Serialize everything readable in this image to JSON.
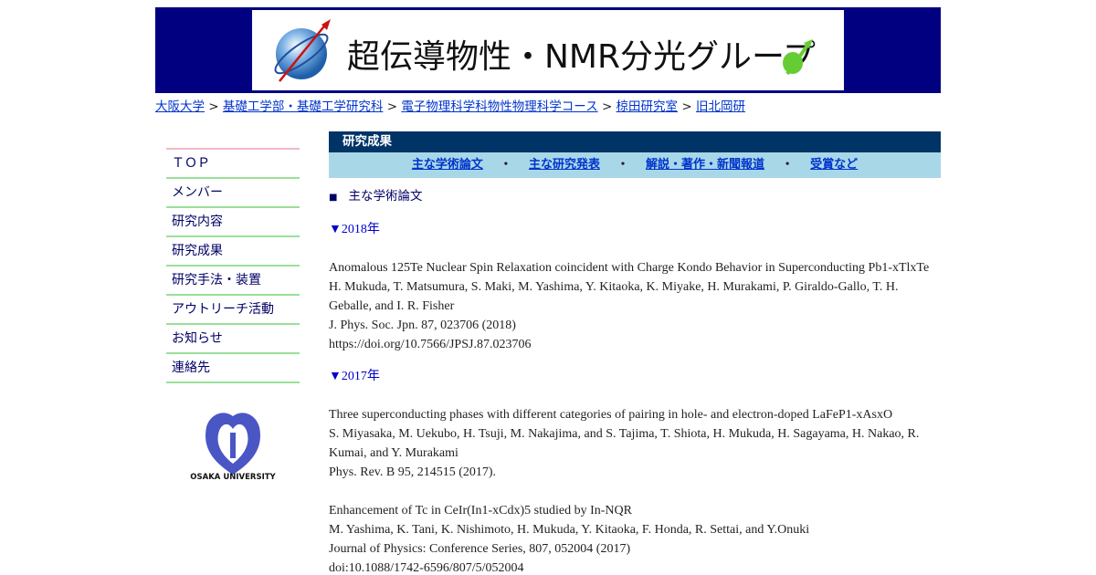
{
  "header": {
    "title": "超伝導物性・NMR分光グループ"
  },
  "breadcrumb": [
    {
      "label": "大阪大学"
    },
    {
      "label": "基礎工学部・基礎工学研究科"
    },
    {
      "label": "電子物理科学科物性物理科学コース"
    },
    {
      "label": "椋田研究室"
    },
    {
      "label": "旧北岡研"
    }
  ],
  "breadcrumb_sep": ">",
  "nav": {
    "items": [
      {
        "label": "ＴＯＰ"
      },
      {
        "label": "メンバー"
      },
      {
        "label": "研究内容"
      },
      {
        "label": "研究成果"
      },
      {
        "label": "研究手法・装置"
      },
      {
        "label": "アウトリーチ活動"
      },
      {
        "label": "お知らせ"
      },
      {
        "label": "連絡先"
      }
    ]
  },
  "logo_text": "OSAKA UNIVERSITY",
  "section": {
    "title": "研究成果"
  },
  "subnav": {
    "links": [
      {
        "label": "主な学術論文"
      },
      {
        "label": "主な研究発表"
      },
      {
        "label": "解説・著作・新聞報道"
      },
      {
        "label": "受賞など"
      }
    ],
    "dot": "・"
  },
  "content": {
    "heading_marker": "■",
    "heading": "主な学術論文",
    "years": [
      {
        "label": "▼2018年",
        "pubs": [
          {
            "lines": [
              "Anomalous 125Te Nuclear Spin Relaxation coincident with Charge Kondo Behavior in Superconducting Pb1-xTlxTe",
              "H. Mukuda, T. Matsumura, S. Maki, M. Yashima, Y. Kitaoka, K. Miyake, H. Murakami, P. Giraldo-Gallo, T. H. Geballe, and I. R. Fisher",
              "J. Phys. Soc. Jpn. 87, 023706 (2018)",
              "https://doi.org/10.7566/JPSJ.87.023706"
            ]
          }
        ]
      },
      {
        "label": "▼2017年",
        "pubs": [
          {
            "lines": [
              "Three superconducting phases with different categories of pairing in hole- and electron-doped LaFeP1-xAsxO",
              "S. Miyasaka, M. Uekubo, H. Tsuji, M. Nakajima, and S. Tajima, T. Shiota, H. Mukuda, H. Sagayama, H. Nakao, R. Kumai, and Y. Murakami",
              "Phys. Rev. B 95, 214515 (2017)."
            ]
          },
          {
            "lines": [
              "Enhancement of Tc in CeIr(In1-xCdx)5 studied by In-NQR",
              "M. Yashima, K. Tani, K. Nishimoto, H. Mukuda, Y. Kitaoka, F. Honda, R. Settai, and Y.Onuki",
              "Journal of Physics: Conference Series, 807, 052004 (2017)",
              "doi:10.1088/1742-6596/807/5/052004"
            ]
          }
        ]
      }
    ]
  },
  "colors": {
    "header_bg": "#000080",
    "section_bar": "#003366",
    "subnav_bg": "#a8d8e8",
    "nav_divider": "#99e099",
    "link": "#0033cc"
  }
}
